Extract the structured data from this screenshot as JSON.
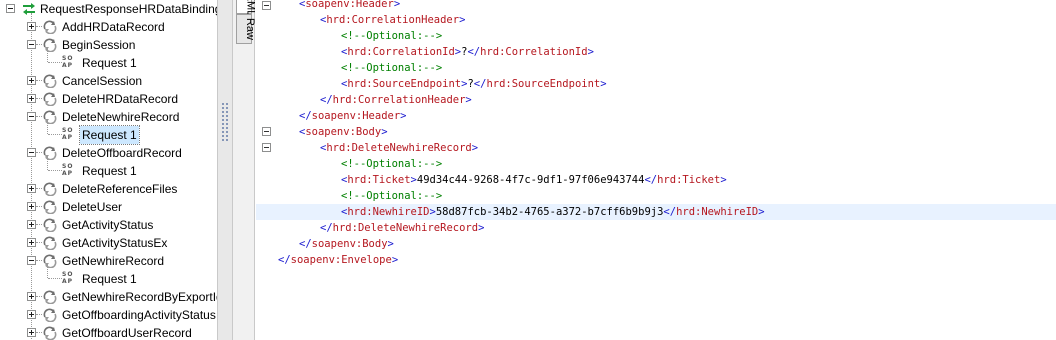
{
  "tree": {
    "root_label": "RequestResponseHRDataBinding",
    "items": [
      {
        "label": "AddHRDataRecord",
        "expanded": false
      },
      {
        "label": "BeginSession",
        "expanded": true,
        "children": [
          "Request 1"
        ]
      },
      {
        "label": "CancelSession",
        "expanded": false
      },
      {
        "label": "DeleteHRDataRecord",
        "expanded": false
      },
      {
        "label": "DeleteNewhireRecord",
        "expanded": true,
        "children": [
          "Request 1"
        ],
        "selected_child": 0
      },
      {
        "label": "DeleteOffboardRecord",
        "expanded": true,
        "children": [
          "Request 1"
        ]
      },
      {
        "label": "DeleteReferenceFiles",
        "expanded": false
      },
      {
        "label": "DeleteUser",
        "expanded": false
      },
      {
        "label": "GetActivityStatus",
        "expanded": false
      },
      {
        "label": "GetActivityStatusEx",
        "expanded": false
      },
      {
        "label": "GetNewhireRecord",
        "expanded": true,
        "children": [
          "Request 1"
        ]
      },
      {
        "label": "GetNewhireRecordByExportId",
        "expanded": false
      },
      {
        "label": "GetOffboardingActivityStatus",
        "expanded": false
      },
      {
        "label": "GetOffboardUserRecord",
        "expanded": false
      }
    ],
    "soap_icon_text": [
      "SO",
      "AP"
    ]
  },
  "tabs": {
    "xml_label": "XML",
    "raw_label": "Raw"
  },
  "editor": {
    "lines": [
      [
        {
          "c": "br",
          "t": "<"
        },
        {
          "c": "tag",
          "t": "soapenv:Header"
        },
        {
          "c": "br",
          "t": ">"
        }
      ],
      [
        {
          "c": "br",
          "t": "<"
        },
        {
          "c": "tag",
          "t": "hrd:CorrelationHeader"
        },
        {
          "c": "br",
          "t": ">"
        }
      ],
      [
        {
          "c": "cmt",
          "t": "<!--Optional:-->"
        }
      ],
      [
        {
          "c": "br",
          "t": "<"
        },
        {
          "c": "tag",
          "t": "hrd:CorrelationId"
        },
        {
          "c": "br",
          "t": ">"
        },
        {
          "c": "txt",
          "t": "?"
        },
        {
          "c": "br",
          "t": "</"
        },
        {
          "c": "tag",
          "t": "hrd:CorrelationId"
        },
        {
          "c": "br",
          "t": ">"
        }
      ],
      [
        {
          "c": "cmt",
          "t": "<!--Optional:-->"
        }
      ],
      [
        {
          "c": "br",
          "t": "<"
        },
        {
          "c": "tag",
          "t": "hrd:SourceEndpoint"
        },
        {
          "c": "br",
          "t": ">"
        },
        {
          "c": "txt",
          "t": "?"
        },
        {
          "c": "br",
          "t": "</"
        },
        {
          "c": "tag",
          "t": "hrd:SourceEndpoint"
        },
        {
          "c": "br",
          "t": ">"
        }
      ],
      [
        {
          "c": "br",
          "t": "</"
        },
        {
          "c": "tag",
          "t": "hrd:CorrelationHeader"
        },
        {
          "c": "br",
          "t": ">"
        }
      ],
      [
        {
          "c": "br",
          "t": "</"
        },
        {
          "c": "tag",
          "t": "soapenv:Header"
        },
        {
          "c": "br",
          "t": ">"
        }
      ],
      [
        {
          "c": "br",
          "t": "<"
        },
        {
          "c": "tag",
          "t": "soapenv:Body"
        },
        {
          "c": "br",
          "t": ">"
        }
      ],
      [
        {
          "c": "br",
          "t": "<"
        },
        {
          "c": "tag",
          "t": "hrd:DeleteNewhireRecord"
        },
        {
          "c": "br",
          "t": ">"
        }
      ],
      [
        {
          "c": "cmt",
          "t": "<!--Optional:-->"
        }
      ],
      [
        {
          "c": "br",
          "t": "<"
        },
        {
          "c": "tag",
          "t": "hrd:Ticket"
        },
        {
          "c": "br",
          "t": ">"
        },
        {
          "c": "txt",
          "t": "49d34c44-9268-4f7c-9df1-97f06e943744"
        },
        {
          "c": "br",
          "t": "</"
        },
        {
          "c": "tag",
          "t": "hrd:Ticket"
        },
        {
          "c": "br",
          "t": ">"
        }
      ],
      [
        {
          "c": "cmt",
          "t": "<!--Optional:-->"
        }
      ],
      [
        {
          "c": "br",
          "t": "<"
        },
        {
          "c": "tag",
          "t": "hrd:NewhireID"
        },
        {
          "c": "br",
          "t": ">"
        },
        {
          "c": "txt",
          "t": "58d87fcb-34b2-4765-a372-b7cff6b9b9j3"
        },
        {
          "c": "br",
          "t": "</"
        },
        {
          "c": "tag",
          "t": "hrd:NewhireID"
        },
        {
          "c": "br",
          "t": ">"
        }
      ],
      [
        {
          "c": "br",
          "t": "</"
        },
        {
          "c": "tag",
          "t": "hrd:DeleteNewhireRecord"
        },
        {
          "c": "br",
          "t": ">"
        }
      ],
      [
        {
          "c": "br",
          "t": "</"
        },
        {
          "c": "tag",
          "t": "soapenv:Body"
        },
        {
          "c": "br",
          "t": ">"
        }
      ],
      [
        {
          "c": "br",
          "t": "</"
        },
        {
          "c": "tag",
          "t": "soapenv:Envelope"
        },
        {
          "c": "br",
          "t": ">"
        }
      ]
    ],
    "highlighted_line": 13
  },
  "colors": {
    "tag": "#b5171f",
    "bracket": "#1b1bcf",
    "comment": "#008000",
    "selection": "#cde8ff",
    "splitter_thumb": "#3d5e9f"
  }
}
